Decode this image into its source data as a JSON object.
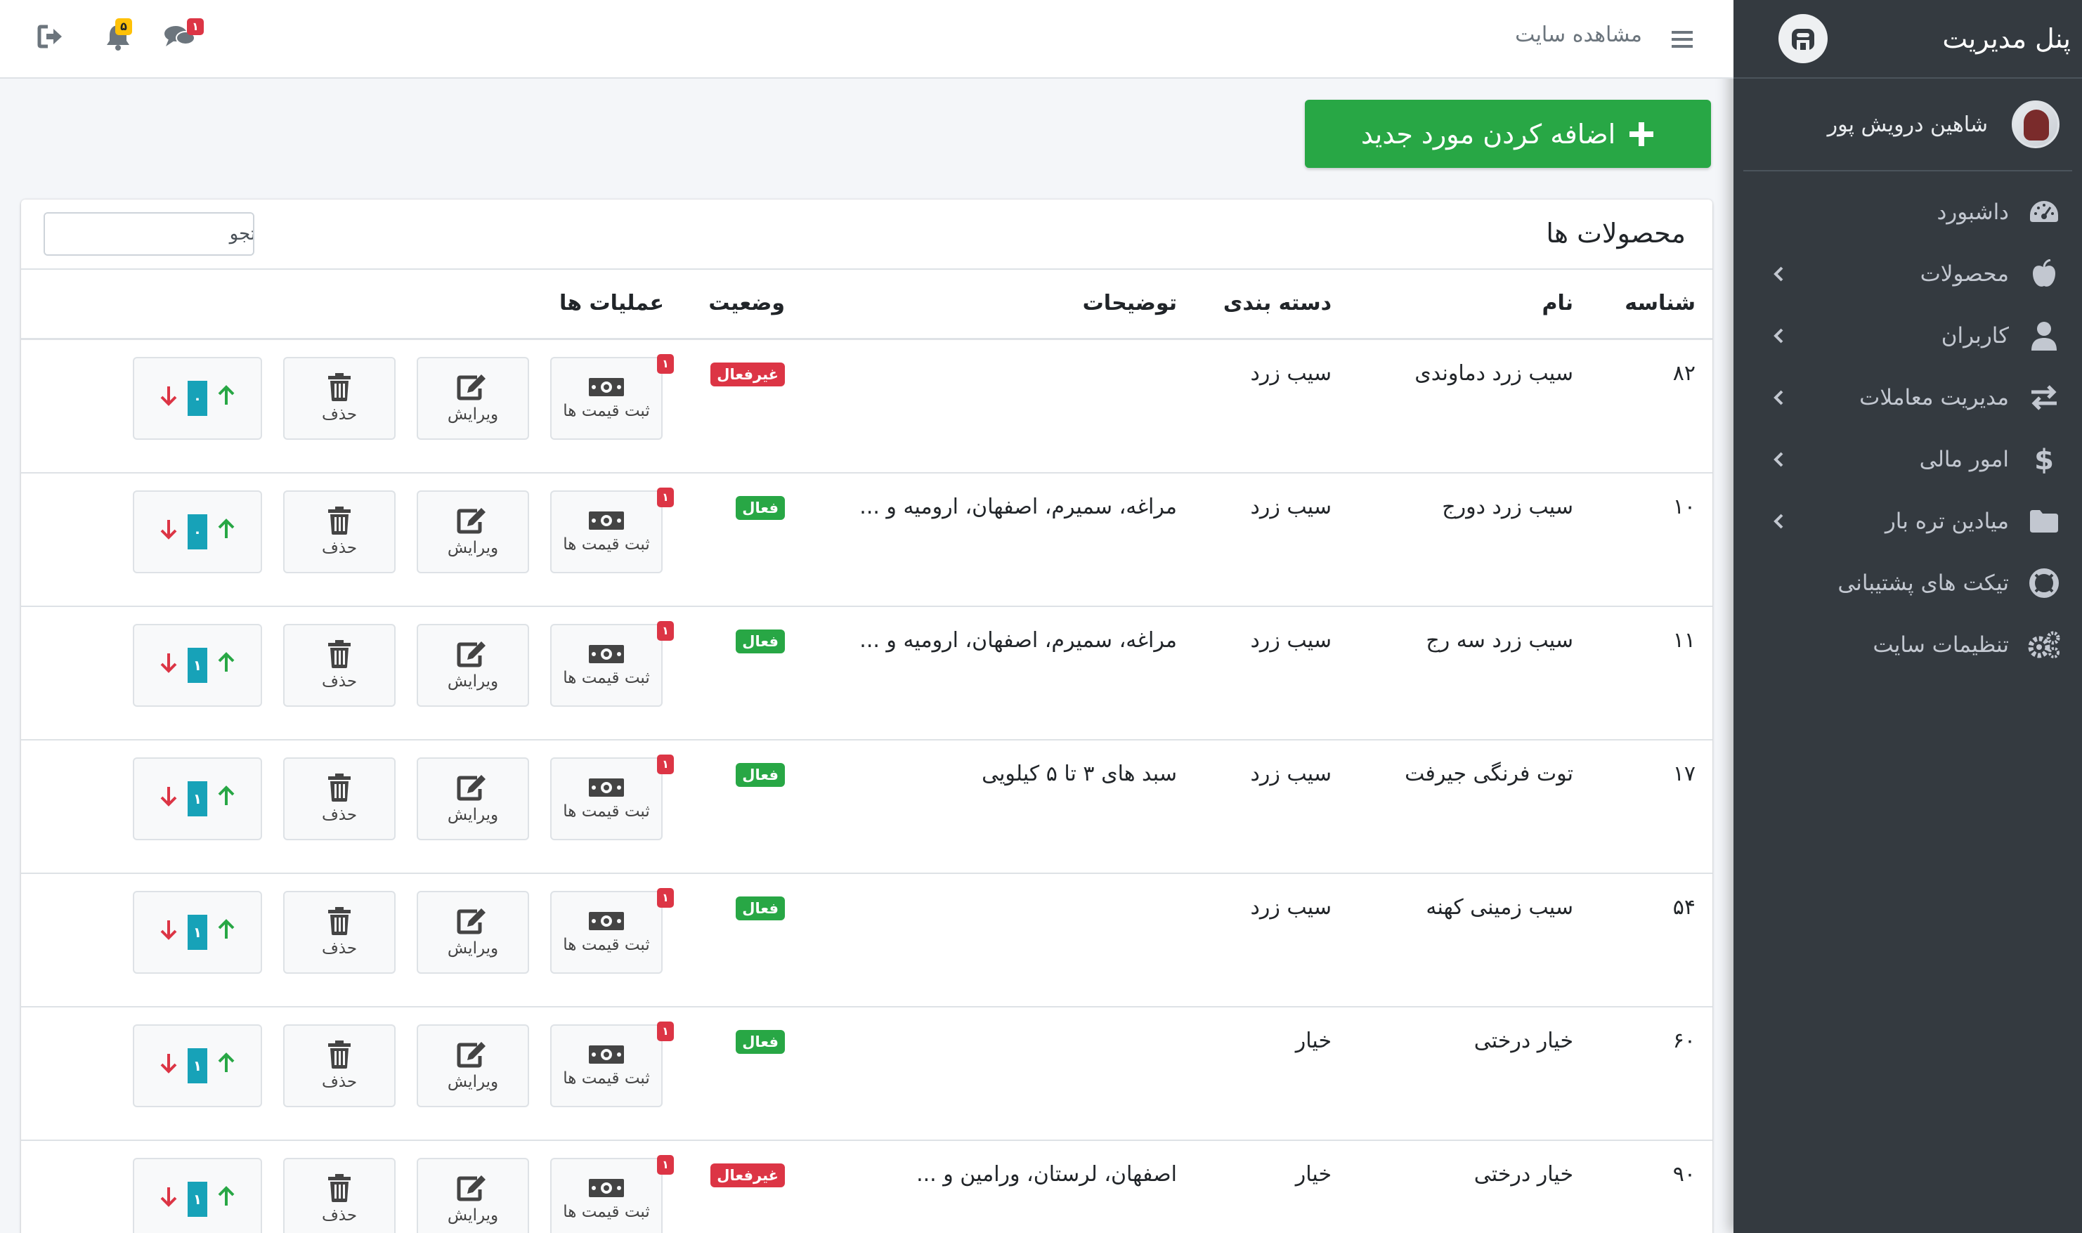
{
  "colors": {
    "sidebar_bg": "#343a40",
    "success": "#28a745",
    "danger": "#dc3545",
    "info": "#17a2b8",
    "warning": "#ffc107"
  },
  "sidebar": {
    "brand": "پنل مدیریت",
    "brand_logo_icon": "brand-logo-icon",
    "user_name": "شاهین درویش پور",
    "items": [
      {
        "label": "داشبورد",
        "icon": "dashboard-icon",
        "has_children": false
      },
      {
        "label": "محصولات",
        "icon": "apple-icon",
        "has_children": true
      },
      {
        "label": "کاربران",
        "icon": "user-icon",
        "has_children": true
      },
      {
        "label": "مدیریت معاملات",
        "icon": "exchange-icon",
        "has_children": true
      },
      {
        "label": "امور مالی",
        "icon": "dollar-icon",
        "has_children": true
      },
      {
        "label": "میادین تره بار",
        "icon": "folder-icon",
        "has_children": true
      },
      {
        "label": "تیکت های پشتیبانی",
        "icon": "life-ring-icon",
        "has_children": false
      },
      {
        "label": "تنظیمات سایت",
        "icon": "gears-icon",
        "has_children": false
      }
    ]
  },
  "topbar": {
    "view_site": "مشاهده سایت",
    "notifications_count": "۵",
    "messages_count": "۱"
  },
  "add_button_label": "اضافه کردن مورد جدید",
  "card": {
    "title": "محصولات ها",
    "search_placeholder": "جستجو"
  },
  "table": {
    "columns": {
      "id": "شناسه",
      "name": "نام",
      "category": "دسته بندی",
      "description": "توضیحات",
      "status": "وضعیت",
      "operations": "عملیات ها"
    },
    "op_labels": {
      "price": "ثبت قیمت ها",
      "edit": "ویرایش",
      "delete": "حذف"
    },
    "rows": [
      {
        "id": "۸۲",
        "name": "سیب زرد دماوندی",
        "category": "سیب زرد",
        "description": "",
        "status": "غیرفعال",
        "active": false,
        "price_badge": "۱",
        "order": "۰"
      },
      {
        "id": "۱۰",
        "name": "سیب زرد دورج",
        "category": "سیب زرد",
        "description": "مراغه، سمیرم، اصفهان، ارومیه و ...",
        "status": "فعال",
        "active": true,
        "price_badge": "۱",
        "order": "۰"
      },
      {
        "id": "۱۱",
        "name": "سیب زرد سه رج",
        "category": "سیب زرد",
        "description": "مراغه، سمیرم، اصفهان، ارومیه و ...",
        "status": "فعال",
        "active": true,
        "price_badge": "۱",
        "order": "۱"
      },
      {
        "id": "۱۷",
        "name": "توت فرنگی جیرفت",
        "category": "سیب زرد",
        "description": "سبد های ۳ تا ۵ کیلویی",
        "status": "فعال",
        "active": true,
        "price_badge": "۱",
        "order": "۱"
      },
      {
        "id": "۵۴",
        "name": "سیب زمینی کهنه",
        "category": "سیب زرد",
        "description": "",
        "status": "فعال",
        "active": true,
        "price_badge": "۱",
        "order": "۱"
      },
      {
        "id": "۶۰",
        "name": "خیار درختی",
        "category": "خیار",
        "description": "",
        "status": "فعال",
        "active": true,
        "price_badge": "۱",
        "order": "۱"
      },
      {
        "id": "۹۰",
        "name": "خیار درختی",
        "category": "خیار",
        "description": "اصفهان، لرستان، ورامین و ...",
        "status": "غیرفعال",
        "active": false,
        "price_badge": "۱",
        "order": "۱"
      }
    ]
  }
}
